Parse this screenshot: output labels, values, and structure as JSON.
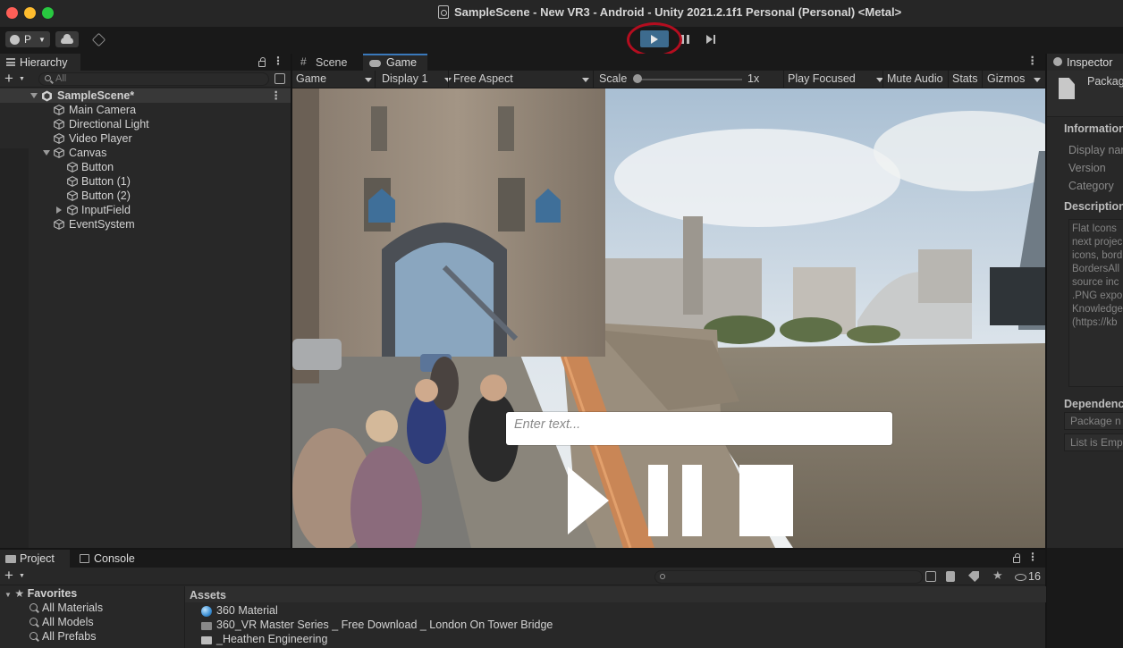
{
  "window": {
    "title": "SampleScene - New VR3 - Android - Unity 2021.2.1f1 Personal (Personal) <Metal>"
  },
  "toolbar": {
    "account_label": "P"
  },
  "hierarchy": {
    "tab_label": "Hierarchy",
    "search_placeholder": "All",
    "scene_name": "SampleScene*",
    "items": [
      {
        "label": "Main Camera"
      },
      {
        "label": "Directional Light"
      },
      {
        "label": "Video Player"
      },
      {
        "label": "Canvas"
      },
      {
        "label": "Button"
      },
      {
        "label": "Button (1)"
      },
      {
        "label": "Button (2)"
      },
      {
        "label": "InputField"
      },
      {
        "label": "EventSystem"
      }
    ]
  },
  "game_view": {
    "tabs": [
      {
        "label": "Scene"
      },
      {
        "label": "Game"
      }
    ],
    "mode": "Game",
    "display": "Display 1",
    "aspect": "Free Aspect",
    "scale_label": "Scale",
    "scale_value": "1x",
    "play_mode": "Play Focused",
    "mute": "Mute Audio",
    "stats": "Stats",
    "gizmos": "Gizmos",
    "input_placeholder": "Enter text..."
  },
  "inspector": {
    "tab_label": "Inspector",
    "header_title": "Packag",
    "section_info": "Information",
    "fields": [
      "Display nam",
      "Version",
      "Category"
    ],
    "section_desc": "Description",
    "description_lines": [
      "Flat Icons",
      "next projec",
      "icons, bord",
      "BordersAll",
      "source inc",
      ".PNG expo",
      "Knowledge",
      "(https://kb"
    ],
    "section_deps": "Dependenc",
    "dep_rows": [
      "Package n",
      "List is Emp"
    ]
  },
  "project": {
    "tabs": [
      {
        "label": "Project"
      },
      {
        "label": "Console"
      }
    ],
    "hidden_count": "16",
    "favorites_label": "Favorites",
    "favorites": [
      {
        "label": "All Materials"
      },
      {
        "label": "All Models"
      },
      {
        "label": "All Prefabs"
      }
    ],
    "assets_label": "Assets",
    "assets": [
      {
        "label": "360 Material"
      },
      {
        "label": "360_VR Master Series _ Free Download _ London On Tower Bridge"
      },
      {
        "label": "_Heathen Engineering"
      }
    ]
  },
  "colors": {
    "accent_play": "#3d6b8e",
    "highlight_ring": "#b40d1f",
    "panel_bg": "#282828"
  }
}
